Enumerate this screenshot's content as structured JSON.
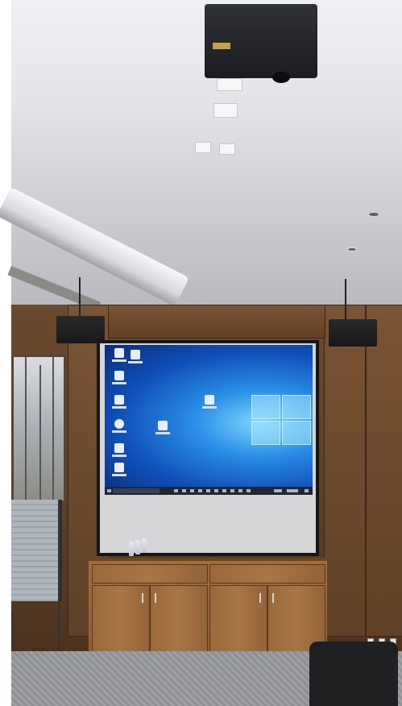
{
  "scene": {
    "description_free": true
  },
  "screen": {
    "desktop_colors": {
      "bg_light": "#7fd6ff",
      "bg_mid": "#2a8fe6",
      "bg_dark": "#0a2d7a",
      "taskbar": "#202632"
    }
  },
  "icons": [
    "recycle-bin-icon",
    "folder-icon",
    "browser-icon",
    "document-icon",
    "settings-icon",
    "windows-logo-icon"
  ]
}
